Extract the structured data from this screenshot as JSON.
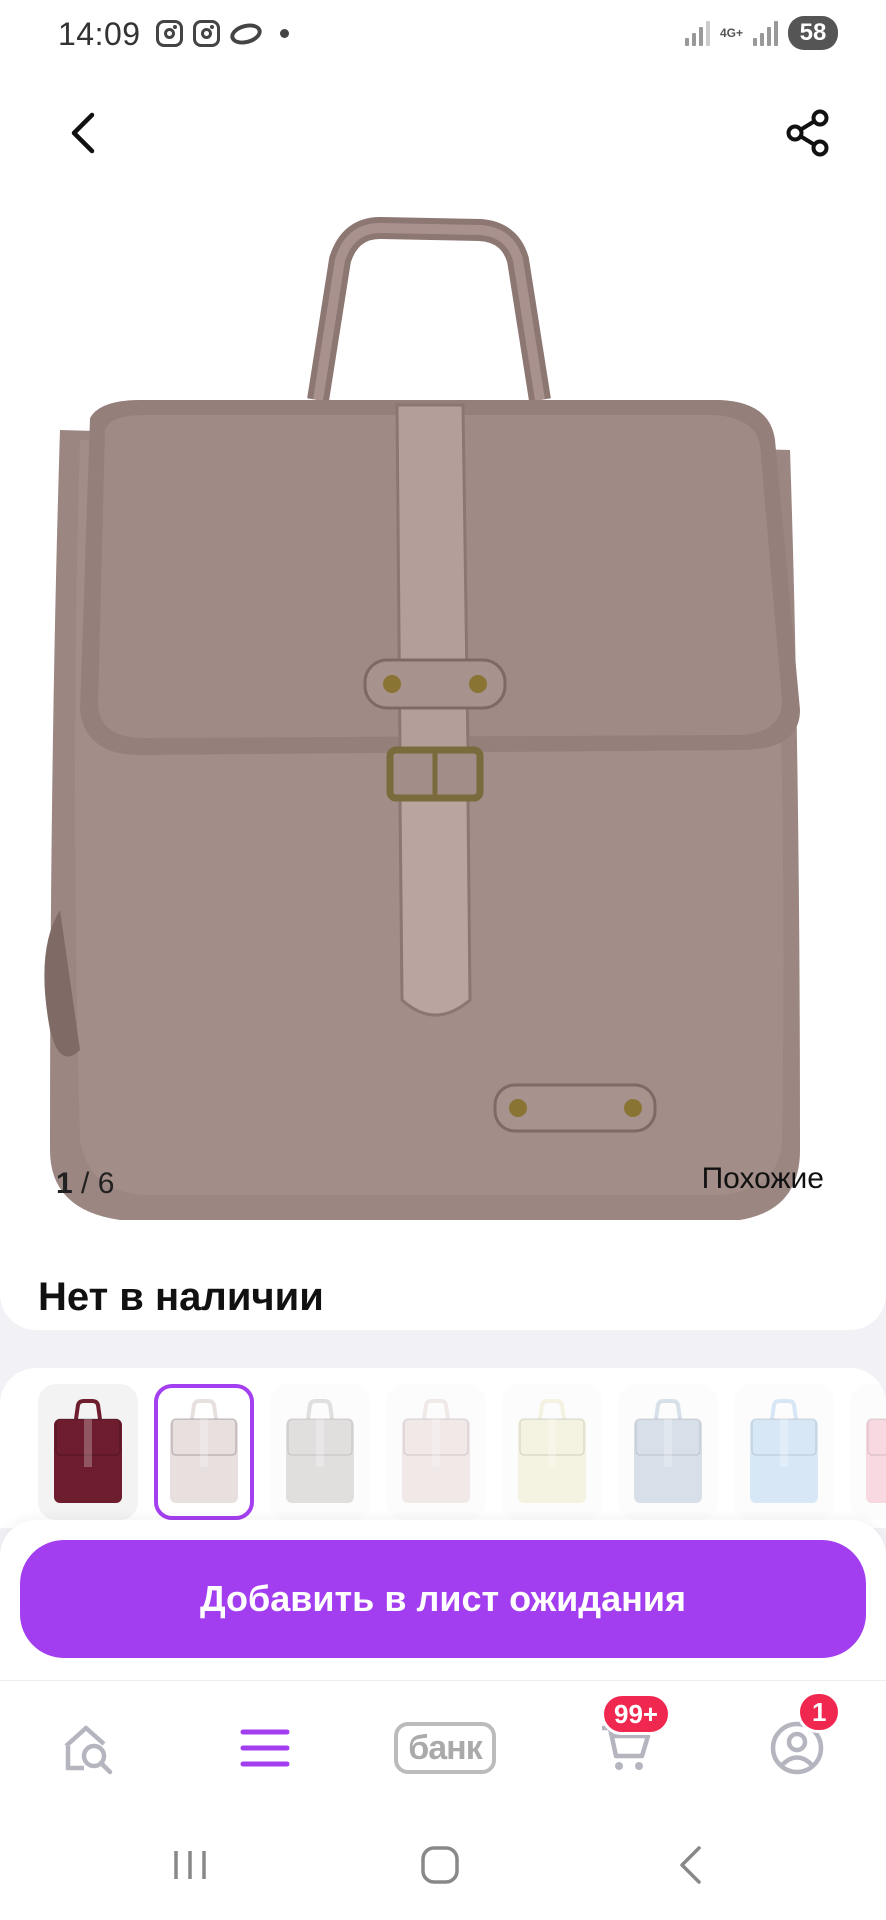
{
  "status_bar": {
    "time": "14:09",
    "network": "4G+",
    "battery": "58"
  },
  "product": {
    "image_index": "1",
    "image_total": "/ 6",
    "similar_label": "Похожие",
    "stock_status": "Нет в наличии",
    "bag_color": "#a08a86"
  },
  "variants": [
    {
      "color": "#6e1d2e",
      "selected": false,
      "faded": false
    },
    {
      "color": "#e8dfdf",
      "selected": true,
      "faded": false
    },
    {
      "color": "#c9c4c4",
      "selected": false,
      "faded": true
    },
    {
      "color": "#e6d6d6",
      "selected": false,
      "faded": true
    },
    {
      "color": "#ece8c8",
      "selected": false,
      "faded": true
    },
    {
      "color": "#b8c6d8",
      "selected": false,
      "faded": true
    },
    {
      "color": "#b6d4ee",
      "selected": false,
      "faded": true
    },
    {
      "color": "#f3b8c8",
      "selected": false,
      "faded": true
    }
  ],
  "cta": {
    "label": "Добавить в лист ожидания"
  },
  "bottom_nav": {
    "bank_label": "банк",
    "cart_badge": "99+",
    "profile_badge": "1",
    "accent_color": "#a33ef0"
  }
}
